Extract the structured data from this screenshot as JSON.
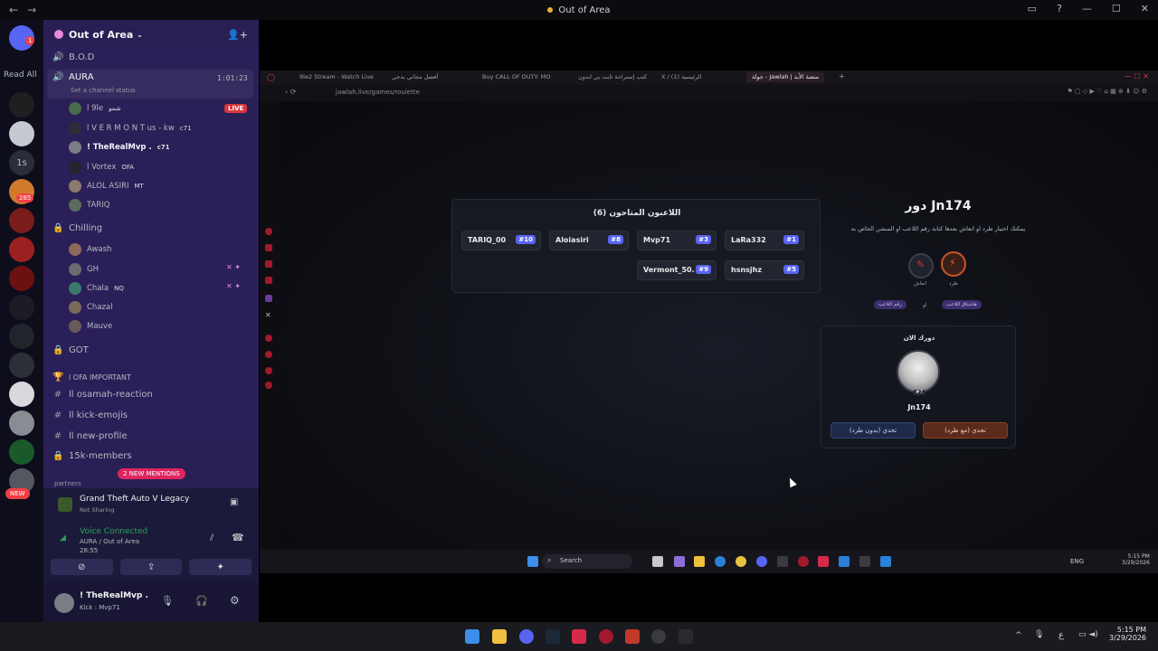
{
  "window": {
    "title": "Out of Area"
  },
  "rail": {
    "read_all": "Read All",
    "badge_top": "1",
    "one_s": "1s",
    "badge_285": "285",
    "new_label": "NEW"
  },
  "server": {
    "name": "Out of Area"
  },
  "channels": {
    "bod": "B.O.D",
    "aura": "AURA",
    "aura_time": "1:01:23",
    "aura_status": "Set a channel status",
    "live": "LIVE",
    "aura_users": [
      {
        "name": "l 9le",
        "tag": "شمو"
      },
      {
        "name": "l V E R M O N T us - kw",
        "tag": "c71"
      },
      {
        "name": "! TheRealMvp .",
        "tag": "c71"
      },
      {
        "name": "l Vortex",
        "tag": "OFA"
      },
      {
        "name": "ALOL ASIRI",
        "tag": "MT"
      },
      {
        "name": "TARIQ",
        "tag": ""
      }
    ],
    "chilling": "Chilling",
    "chilling_users": [
      {
        "name": "Awash",
        "tag": ""
      },
      {
        "name": "GH",
        "tag": ""
      },
      {
        "name": "Chala",
        "tag": "NQ"
      },
      {
        "name": "Chazal",
        "tag": ""
      },
      {
        "name": "Mauve",
        "tag": ""
      }
    ],
    "got": "GOT",
    "ofa_important": "l OFA IMPORTANT",
    "text_channels": [
      "ll osamah-reaction",
      "ll kick-emojis",
      "ll new-profile",
      "15k-members"
    ],
    "partners": "partners",
    "new_mentions": "2 NEW MENTIONS"
  },
  "game": {
    "title": "Grand Theft Auto V Legacy",
    "sub": "Not Sharing"
  },
  "voice": {
    "status": "Voice Connected",
    "channel": "AURA / Out of Area",
    "time": "28:55"
  },
  "user": {
    "name": "! TheRealMvp .",
    "sub": "Kick : Mvp71"
  },
  "browser": {
    "tabs": [
      "9le2 Stream - Watch Live",
      "أفضل مجاني بدجي",
      "Buy CALL OF DUTY: MO",
      "كتب إستراحة ثابت بي ابدون",
      "X / الرئيسية (1)",
      "جولة - Jawlah | منصة الأبد"
    ],
    "url": "jawlah.live/games/roulette"
  },
  "game_page": {
    "players_title": "اللاعبون المتاحون (6)",
    "players": [
      {
        "name": "TARIQ_00",
        "rank": "#10"
      },
      {
        "name": "Aloiasiri",
        "rank": "#8"
      },
      {
        "name": "Mvp71",
        "rank": "#3"
      },
      {
        "name": "LaRa332",
        "rank": "#1"
      },
      {
        "name": "Vermont_50...",
        "rank": "#9"
      },
      {
        "name": "hsnsjhz",
        "rank": "#5"
      }
    ],
    "turn_title": "دور Jn174",
    "turn_desc": "يمكنك اختيار طرد او انعاش بعدها كتابة رقم اللاعب او المنشن الخاص به",
    "opt_revive": "انعاش",
    "opt_kick": "طرد",
    "chip_random": "رقم اللاعب",
    "chip_mention": "هاشتاق اللاعب",
    "or": "او",
    "your_turn": "دورك الان",
    "avatar_rank": "#7",
    "player_name": "Jn174",
    "btn_no_ban": "تحدي (بدون طرد)",
    "btn_ban": "تحدي (مع طرد)"
  },
  "inner_taskbar": {
    "search": "Search",
    "lang": "ENG",
    "time": "5:15 PM",
    "date": "3/29/2026"
  },
  "outer_taskbar": {
    "lang": "ع",
    "time": "5:15 PM",
    "date": "3/29/2026"
  }
}
